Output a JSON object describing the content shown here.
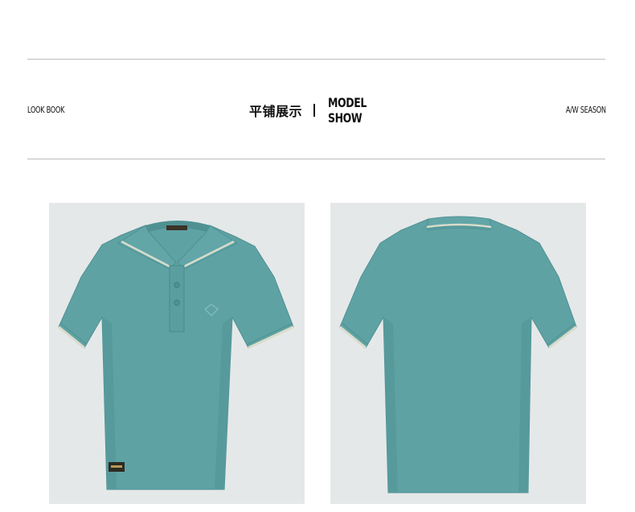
{
  "header": {
    "left_label": "LOOK BOOK",
    "title_cn": "平铺展示",
    "title_en": "MODEL SHOW",
    "right_label": "A/W SEASON"
  },
  "colors": {
    "shirt": "#5fa2a4",
    "shirt_shadow": "#4f9193",
    "tipping": "#d9dccb",
    "photo_background": "#e5e8e9",
    "rule": "#bdbdbd"
  },
  "products": [
    {
      "view": "front"
    },
    {
      "view": "back"
    }
  ]
}
